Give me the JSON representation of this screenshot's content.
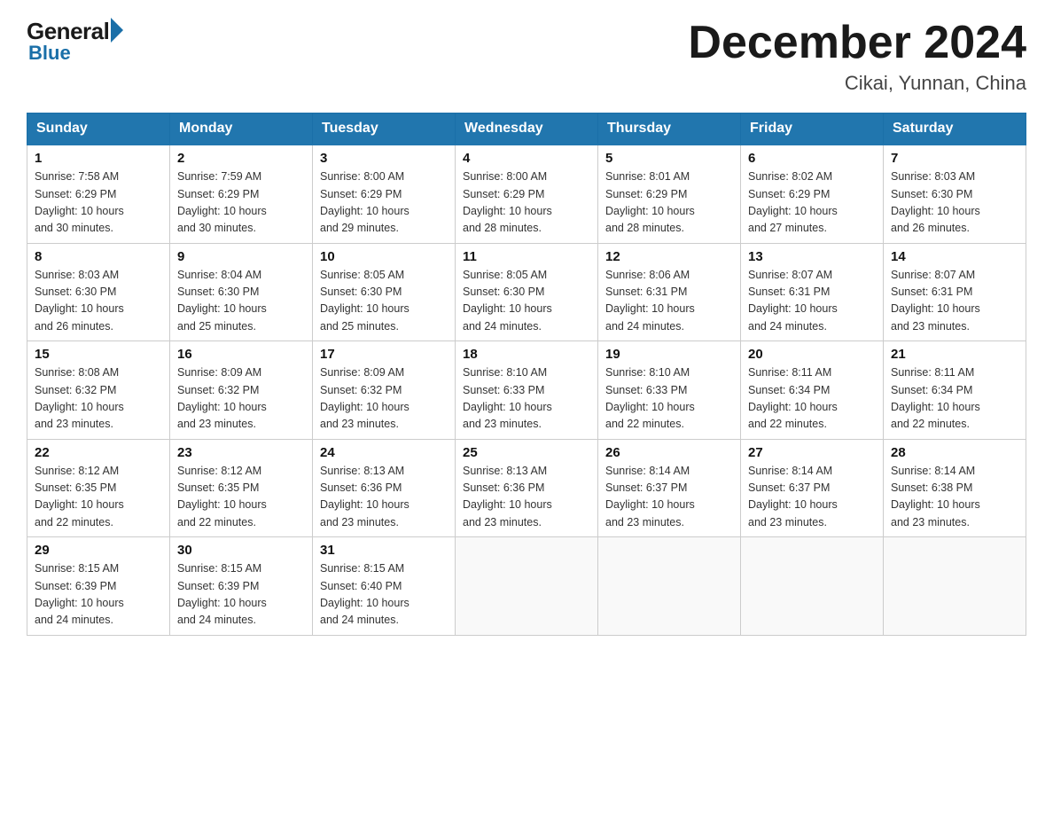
{
  "header": {
    "logo": {
      "general": "General",
      "blue": "Blue"
    },
    "title": "December 2024",
    "location": "Cikai, Yunnan, China"
  },
  "days_of_week": [
    "Sunday",
    "Monday",
    "Tuesday",
    "Wednesday",
    "Thursday",
    "Friday",
    "Saturday"
  ],
  "weeks": [
    [
      {
        "day": "1",
        "sunrise": "7:58 AM",
        "sunset": "6:29 PM",
        "daylight": "10 hours and 30 minutes."
      },
      {
        "day": "2",
        "sunrise": "7:59 AM",
        "sunset": "6:29 PM",
        "daylight": "10 hours and 30 minutes."
      },
      {
        "day": "3",
        "sunrise": "8:00 AM",
        "sunset": "6:29 PM",
        "daylight": "10 hours and 29 minutes."
      },
      {
        "day": "4",
        "sunrise": "8:00 AM",
        "sunset": "6:29 PM",
        "daylight": "10 hours and 28 minutes."
      },
      {
        "day": "5",
        "sunrise": "8:01 AM",
        "sunset": "6:29 PM",
        "daylight": "10 hours and 28 minutes."
      },
      {
        "day": "6",
        "sunrise": "8:02 AM",
        "sunset": "6:29 PM",
        "daylight": "10 hours and 27 minutes."
      },
      {
        "day": "7",
        "sunrise": "8:03 AM",
        "sunset": "6:30 PM",
        "daylight": "10 hours and 26 minutes."
      }
    ],
    [
      {
        "day": "8",
        "sunrise": "8:03 AM",
        "sunset": "6:30 PM",
        "daylight": "10 hours and 26 minutes."
      },
      {
        "day": "9",
        "sunrise": "8:04 AM",
        "sunset": "6:30 PM",
        "daylight": "10 hours and 25 minutes."
      },
      {
        "day": "10",
        "sunrise": "8:05 AM",
        "sunset": "6:30 PM",
        "daylight": "10 hours and 25 minutes."
      },
      {
        "day": "11",
        "sunrise": "8:05 AM",
        "sunset": "6:30 PM",
        "daylight": "10 hours and 24 minutes."
      },
      {
        "day": "12",
        "sunrise": "8:06 AM",
        "sunset": "6:31 PM",
        "daylight": "10 hours and 24 minutes."
      },
      {
        "day": "13",
        "sunrise": "8:07 AM",
        "sunset": "6:31 PM",
        "daylight": "10 hours and 24 minutes."
      },
      {
        "day": "14",
        "sunrise": "8:07 AM",
        "sunset": "6:31 PM",
        "daylight": "10 hours and 23 minutes."
      }
    ],
    [
      {
        "day": "15",
        "sunrise": "8:08 AM",
        "sunset": "6:32 PM",
        "daylight": "10 hours and 23 minutes."
      },
      {
        "day": "16",
        "sunrise": "8:09 AM",
        "sunset": "6:32 PM",
        "daylight": "10 hours and 23 minutes."
      },
      {
        "day": "17",
        "sunrise": "8:09 AM",
        "sunset": "6:32 PM",
        "daylight": "10 hours and 23 minutes."
      },
      {
        "day": "18",
        "sunrise": "8:10 AM",
        "sunset": "6:33 PM",
        "daylight": "10 hours and 23 minutes."
      },
      {
        "day": "19",
        "sunrise": "8:10 AM",
        "sunset": "6:33 PM",
        "daylight": "10 hours and 22 minutes."
      },
      {
        "day": "20",
        "sunrise": "8:11 AM",
        "sunset": "6:34 PM",
        "daylight": "10 hours and 22 minutes."
      },
      {
        "day": "21",
        "sunrise": "8:11 AM",
        "sunset": "6:34 PM",
        "daylight": "10 hours and 22 minutes."
      }
    ],
    [
      {
        "day": "22",
        "sunrise": "8:12 AM",
        "sunset": "6:35 PM",
        "daylight": "10 hours and 22 minutes."
      },
      {
        "day": "23",
        "sunrise": "8:12 AM",
        "sunset": "6:35 PM",
        "daylight": "10 hours and 22 minutes."
      },
      {
        "day": "24",
        "sunrise": "8:13 AM",
        "sunset": "6:36 PM",
        "daylight": "10 hours and 23 minutes."
      },
      {
        "day": "25",
        "sunrise": "8:13 AM",
        "sunset": "6:36 PM",
        "daylight": "10 hours and 23 minutes."
      },
      {
        "day": "26",
        "sunrise": "8:14 AM",
        "sunset": "6:37 PM",
        "daylight": "10 hours and 23 minutes."
      },
      {
        "day": "27",
        "sunrise": "8:14 AM",
        "sunset": "6:37 PM",
        "daylight": "10 hours and 23 minutes."
      },
      {
        "day": "28",
        "sunrise": "8:14 AM",
        "sunset": "6:38 PM",
        "daylight": "10 hours and 23 minutes."
      }
    ],
    [
      {
        "day": "29",
        "sunrise": "8:15 AM",
        "sunset": "6:39 PM",
        "daylight": "10 hours and 24 minutes."
      },
      {
        "day": "30",
        "sunrise": "8:15 AM",
        "sunset": "6:39 PM",
        "daylight": "10 hours and 24 minutes."
      },
      {
        "day": "31",
        "sunrise": "8:15 AM",
        "sunset": "6:40 PM",
        "daylight": "10 hours and 24 minutes."
      },
      null,
      null,
      null,
      null
    ]
  ],
  "labels": {
    "sunrise": "Sunrise:",
    "sunset": "Sunset:",
    "daylight": "Daylight:"
  }
}
